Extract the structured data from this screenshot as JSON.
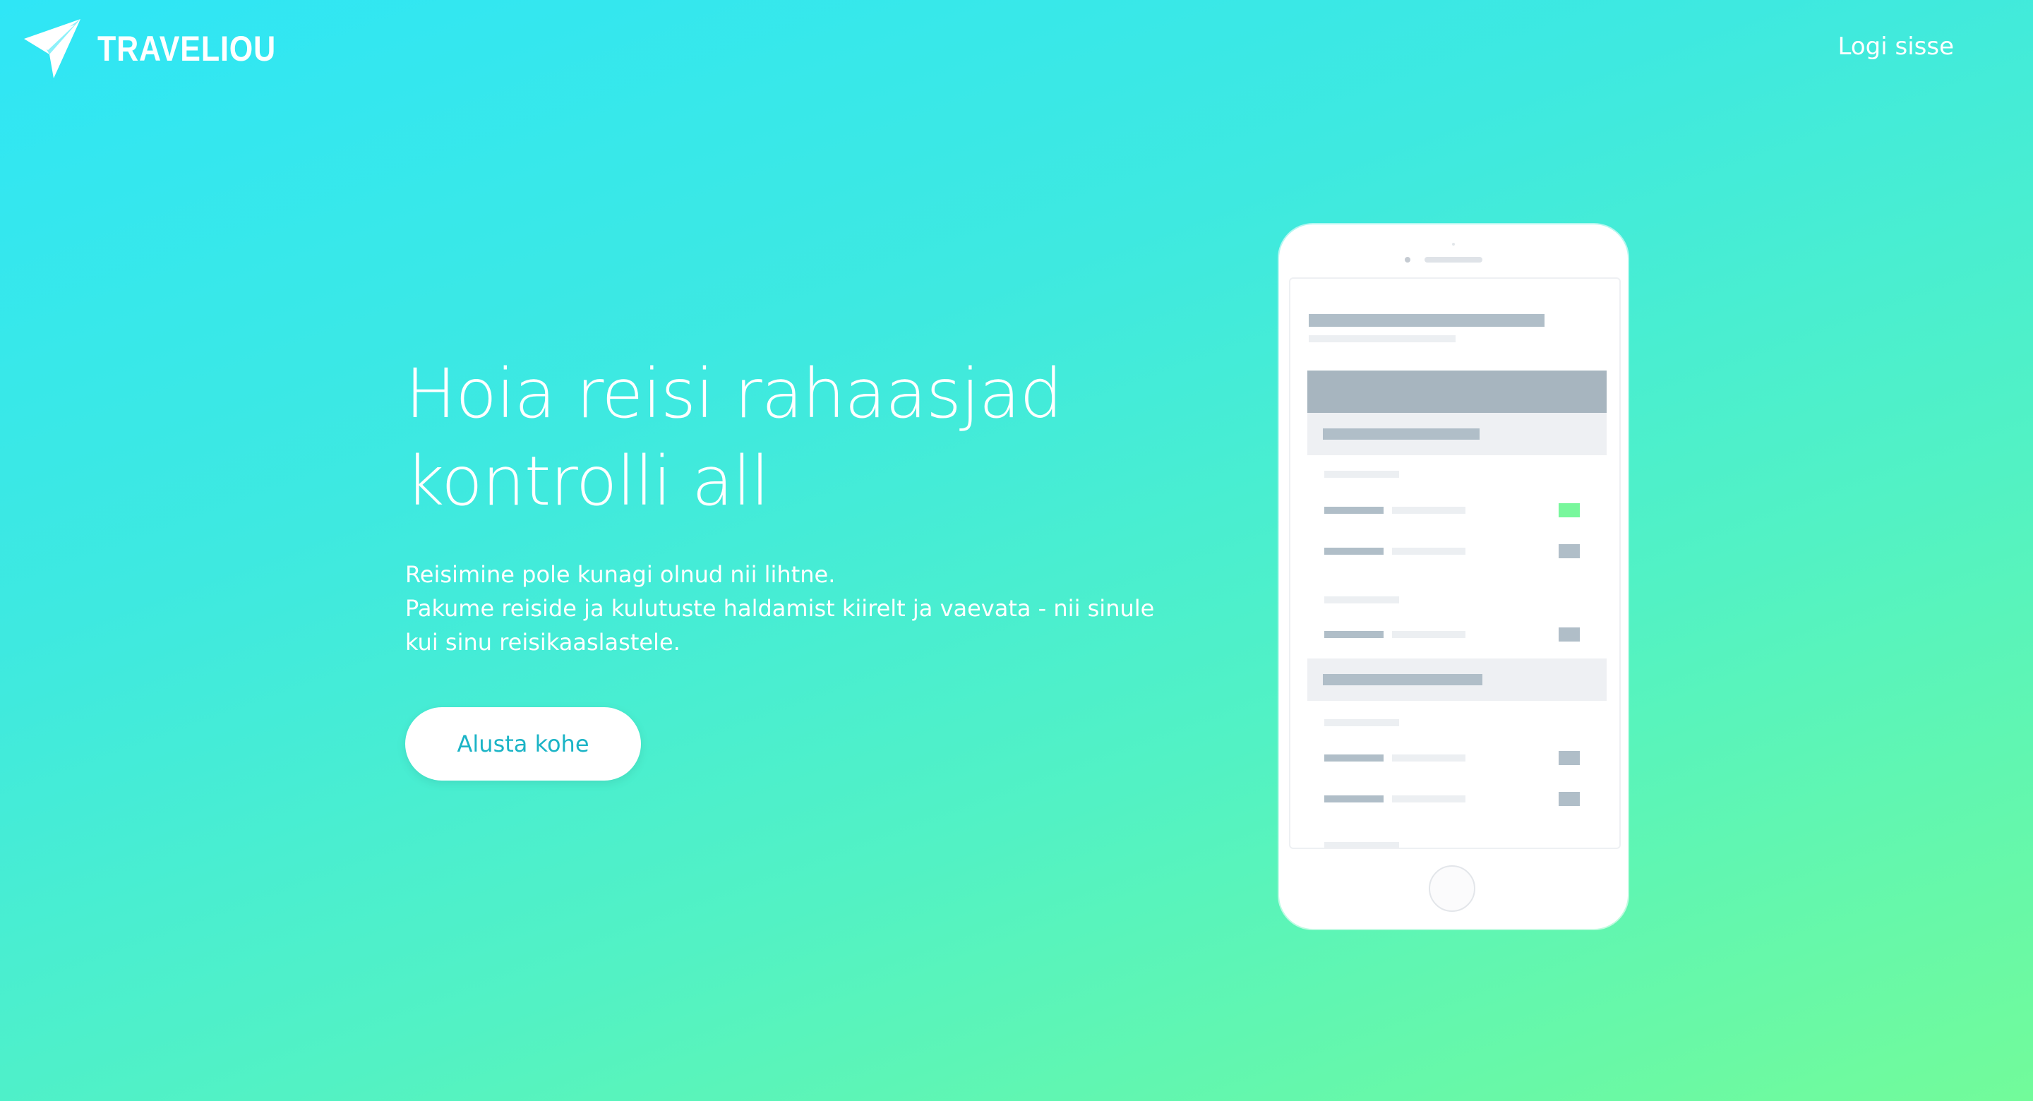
{
  "header": {
    "brand": "TRAVELIOU",
    "logo_icon": "paper-plane-icon",
    "login_label": "Logi sisse"
  },
  "hero": {
    "title_lines": [
      "Hoia reisi rahaasjad",
      "kontrolli all"
    ],
    "description_lines": [
      "Reisimine pole kunagi olnud nii lihtne.",
      "Pakume reiside ja kulutuste haldamist kiirelt ja vaevata - nii sinule",
      "kui sinu reisikaaslastele."
    ],
    "cta_label": "Alusta kohe"
  },
  "colors": {
    "gradient_start": "#2fe6f6",
    "gradient_end": "#72fb9a",
    "cta_text": "#1bb4c6",
    "phone_placeholder": "#a7b5bf",
    "phone_accent": "#78f79c"
  },
  "phone_mockup": {
    "icon": "smartphone-icon",
    "row_status": [
      "accent",
      "neutral",
      "neutral",
      "neutral",
      "neutral"
    ]
  }
}
